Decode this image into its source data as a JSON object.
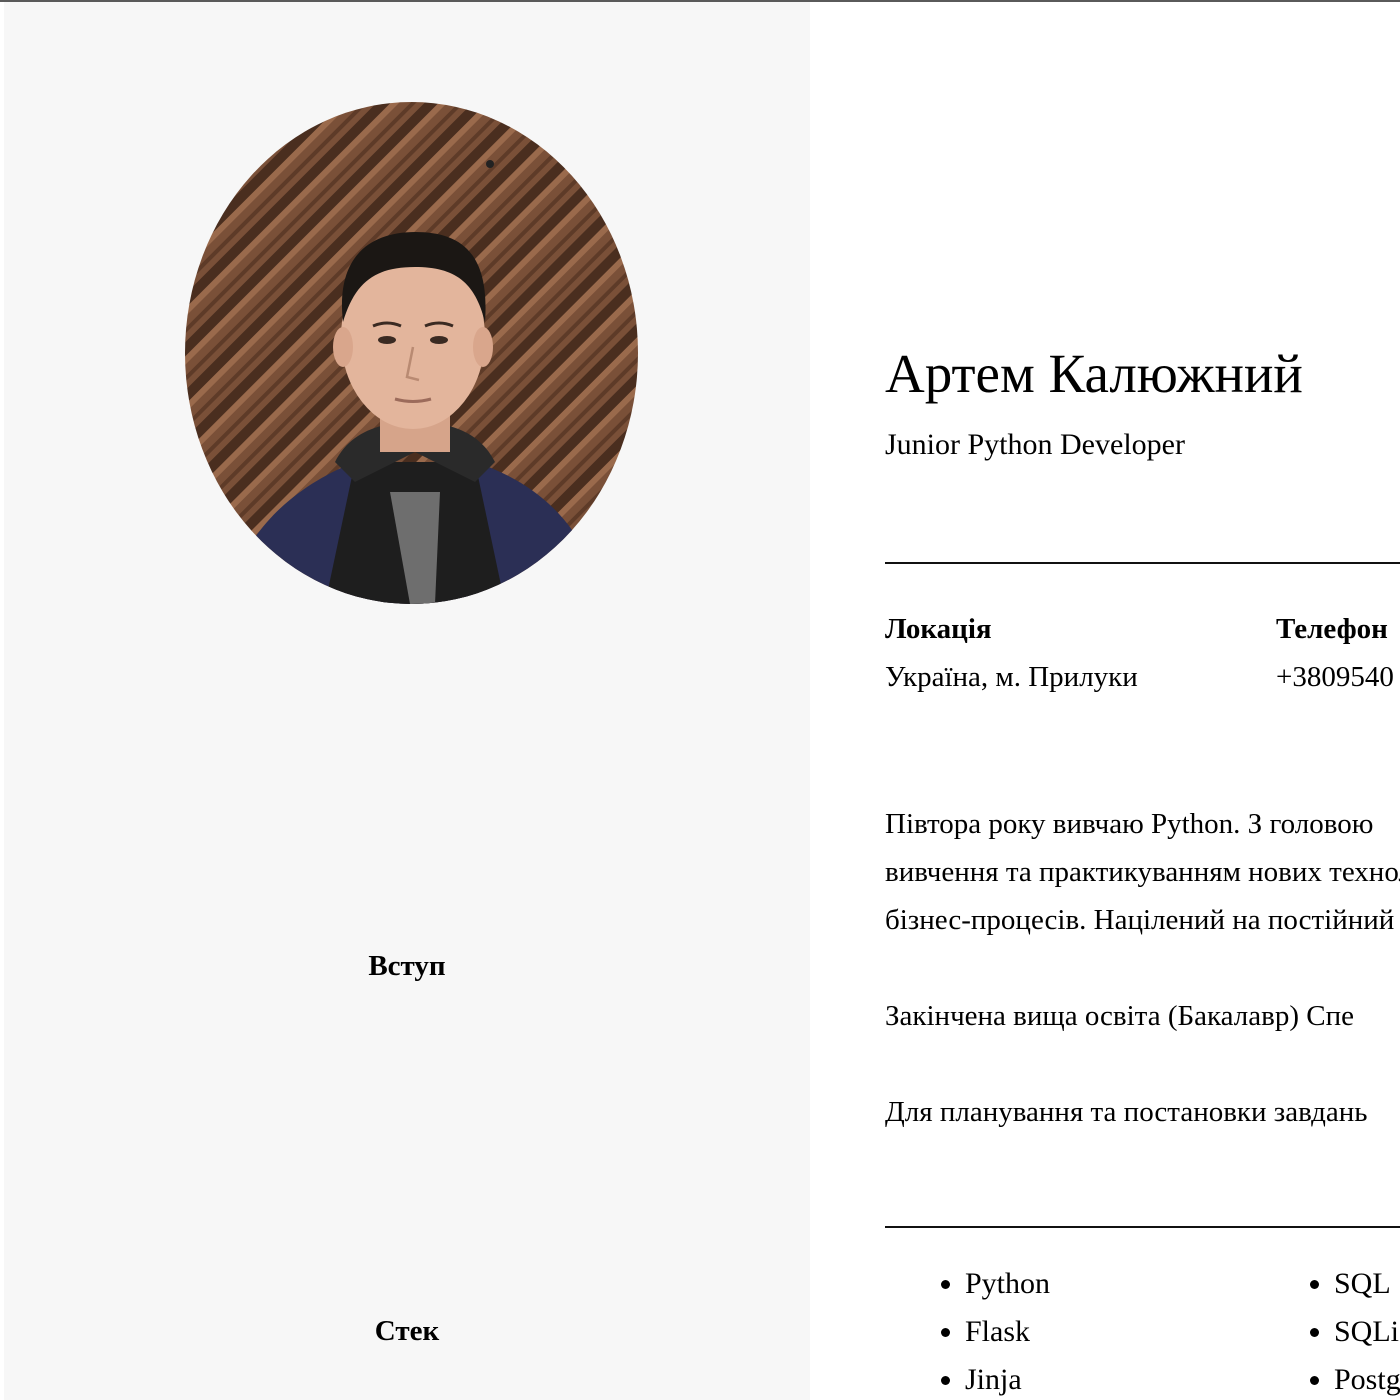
{
  "sidebar": {
    "photo_alt": "Фото Артема Калюжного",
    "sections": [
      "Вступ",
      "Стек"
    ]
  },
  "profile": {
    "name": "Артем Калюжний",
    "role": "Junior Python Developer"
  },
  "contacts": [
    {
      "label": "Локація",
      "value": "Україна, м. Прилуки"
    },
    {
      "label": "Телефон",
      "value": "+3809540"
    }
  ],
  "intro": {
    "paragraph1": [
      "Півтора року вивчаю Python. З головою",
      "вивчення та практикуванням нових технологій",
      "бізнес-процесів. Націлений на постійний"
    ],
    "paragraph2": "Закінчена вища освіта (Бакалавр) Спе",
    "paragraph3": "Для планування та постановки завдань"
  },
  "stack": {
    "column1": [
      "Python",
      "Flask",
      "Jinja"
    ],
    "column2": [
      "SQL",
      "SQLi",
      "Postg"
    ]
  }
}
